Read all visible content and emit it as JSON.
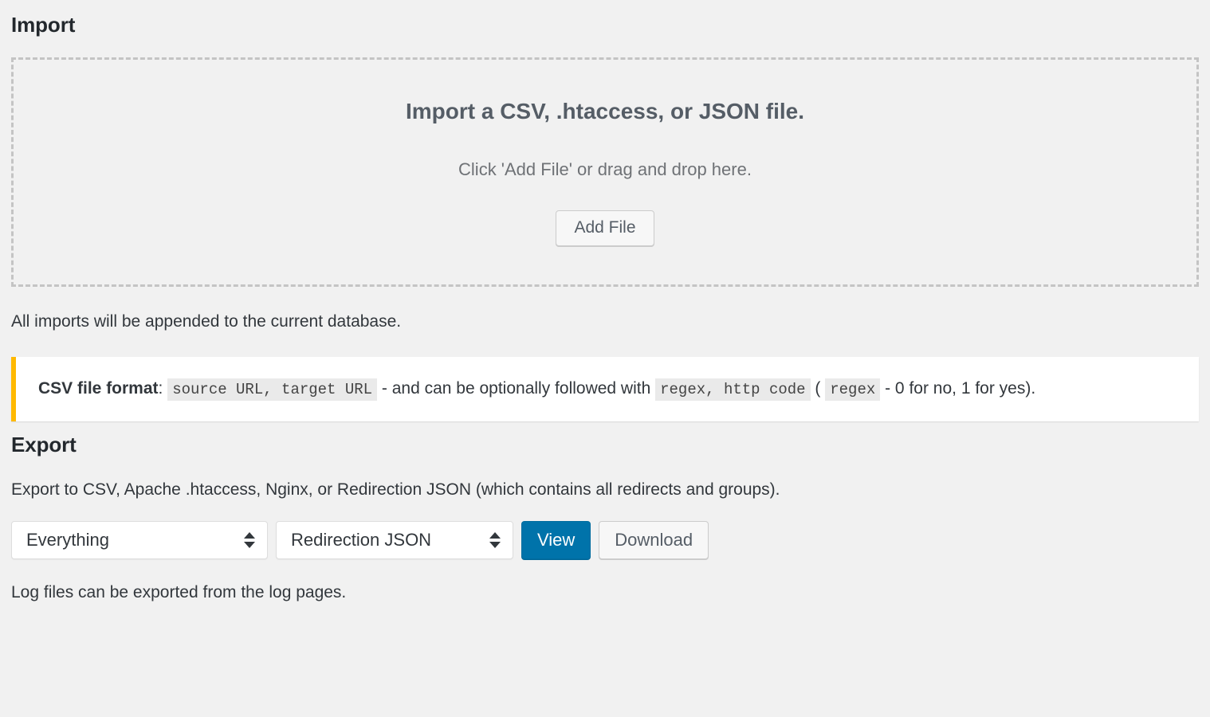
{
  "import": {
    "heading": "Import",
    "dropzone": {
      "title": "Import a CSV, .htaccess, or JSON file.",
      "subtitle": "Click 'Add File' or drag and drop here.",
      "button_label": "Add File"
    },
    "append_note": "All imports will be appended to the current database.",
    "notice": {
      "label": "CSV file format",
      "colon": ":",
      "code_1": "source URL, target URL",
      "text_1": "- and can be optionally followed with",
      "code_2": "regex, http code",
      "text_2": "(",
      "code_3": "regex",
      "text_3": "- 0 for no, 1 for yes)."
    }
  },
  "export": {
    "heading": "Export",
    "description": "Export to CSV, Apache .htaccess, Nginx, or Redirection JSON (which contains all redirects and groups).",
    "scope_select": {
      "value": "Everything",
      "options": [
        "Everything"
      ]
    },
    "format_select": {
      "value": "Redirection JSON",
      "options": [
        "Redirection JSON"
      ]
    },
    "view_label": "View",
    "download_label": "Download",
    "log_note": "Log files can be exported from the log pages."
  },
  "colors": {
    "page_background": "#f1f1f1",
    "heading": "#23282d",
    "primary_button": "#0073aa",
    "notice_accent": "#ffb900",
    "dashed_border": "#c4c4c4",
    "code_background": "#eaeaea"
  }
}
